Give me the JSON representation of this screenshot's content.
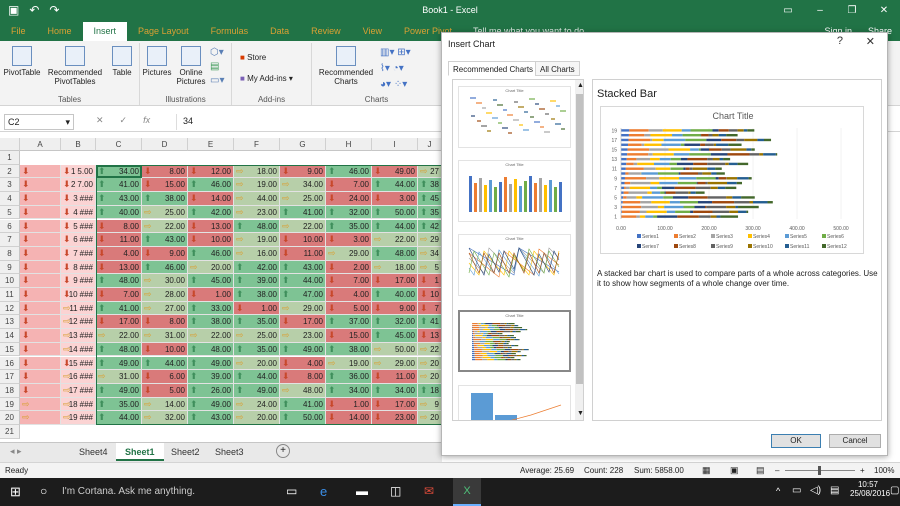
{
  "window": {
    "title": "Book1 - Excel",
    "qat_icons": [
      "save-icon",
      "undo-icon",
      "redo-icon"
    ]
  },
  "ribbon_tabs": [
    "File",
    "Home",
    "Insert",
    "Page Layout",
    "Formulas",
    "Data",
    "Review",
    "View",
    "Power Pivot"
  ],
  "active_tab": "Insert",
  "tell_me": "Tell me what you want to do",
  "sign_in": "Sign in",
  "share": "Share",
  "ribbon": {
    "tables": {
      "label": "Tables",
      "buttons": [
        "PivotTable",
        "Recommended PivotTables",
        "Table"
      ]
    },
    "illustrations": {
      "label": "Illustrations",
      "buttons": [
        "Pictures",
        "Online Pictures"
      ]
    },
    "addins": {
      "label": "Add-ins",
      "store": "Store",
      "my_addins": "My Add-ins"
    },
    "charts": {
      "label": "Charts",
      "recommended": "Recommended Charts"
    }
  },
  "formula_bar": {
    "name_box": "C2",
    "fx_label": "fx",
    "value": "34"
  },
  "columns": [
    "A",
    "B",
    "C",
    "D",
    "E",
    "F",
    "G",
    "H",
    "I",
    "J"
  ],
  "rows": [
    {
      "n": "2",
      "cells": [
        [
          "dn",
          ""
        ],
        [
          "dn",
          "1"
        ],
        [
          "up",
          "34.00"
        ],
        [
          "dn",
          "8.00"
        ],
        [
          "dn",
          "12.00"
        ],
        [
          "rt",
          "18.00"
        ],
        [
          "dn",
          "9.00"
        ],
        [
          "up",
          "46.00"
        ],
        [
          "dn",
          "49.00"
        ],
        [
          "rt",
          "27"
        ]
      ],
      "b2": "5.00"
    },
    {
      "n": "3",
      "cells": [
        [
          "dn",
          ""
        ],
        [
          "dn",
          "2"
        ],
        [
          "up",
          "41.00"
        ],
        [
          "dn",
          "15.00"
        ],
        [
          "up",
          "46.00"
        ],
        [
          "rt",
          "19.00"
        ],
        [
          "rt",
          "34.00"
        ],
        [
          "dn",
          "7.00"
        ],
        [
          "up",
          "44.00"
        ],
        [
          "up",
          "38"
        ]
      ],
      "b2": "7.00"
    },
    {
      "n": "4",
      "cells": [
        [
          "dn",
          ""
        ],
        [
          "dn",
          "3"
        ],
        [
          "up",
          "43.00"
        ],
        [
          "up",
          "38.00"
        ],
        [
          "dn",
          "14.00"
        ],
        [
          "rt",
          "44.00"
        ],
        [
          "rt",
          "25.00"
        ],
        [
          "dn",
          "24.00"
        ],
        [
          "dn",
          "3.00"
        ],
        [
          "up",
          "45"
        ]
      ],
      "b2": "###"
    },
    {
      "n": "5",
      "cells": [
        [
          "dn",
          ""
        ],
        [
          "dn",
          "4"
        ],
        [
          "up",
          "40.00"
        ],
        [
          "rt",
          "25.00"
        ],
        [
          "up",
          "42.00"
        ],
        [
          "rt",
          "23.00"
        ],
        [
          "up",
          "41.00"
        ],
        [
          "up",
          "32.00"
        ],
        [
          "up",
          "50.00"
        ],
        [
          "up",
          "35"
        ]
      ],
      "b2": "###"
    },
    {
      "n": "6",
      "cells": [
        [
          "dn",
          ""
        ],
        [
          "dn",
          "5"
        ],
        [
          "dn",
          "8.00"
        ],
        [
          "rt",
          "22.00"
        ],
        [
          "dn",
          "13.00"
        ],
        [
          "up",
          "48.00"
        ],
        [
          "rt",
          "22.00"
        ],
        [
          "up",
          "35.00"
        ],
        [
          "up",
          "44.00"
        ],
        [
          "up",
          "42"
        ]
      ],
      "b2": "###"
    },
    {
      "n": "7",
      "cells": [
        [
          "dn",
          ""
        ],
        [
          "dn",
          "6"
        ],
        [
          "dn",
          "11.00"
        ],
        [
          "up",
          "43.00"
        ],
        [
          "dn",
          "10.00"
        ],
        [
          "rt",
          "19.00"
        ],
        [
          "dn",
          "10.00"
        ],
        [
          "dn",
          "3.00"
        ],
        [
          "rt",
          "22.00"
        ],
        [
          "rt",
          "29"
        ]
      ],
      "b2": "###"
    },
    {
      "n": "8",
      "cells": [
        [
          "dn",
          ""
        ],
        [
          "dn",
          "7"
        ],
        [
          "dn",
          "4.00"
        ],
        [
          "dn",
          "9.00"
        ],
        [
          "up",
          "46.00"
        ],
        [
          "rt",
          "16.00"
        ],
        [
          "dn",
          "11.00"
        ],
        [
          "rt",
          "29.00"
        ],
        [
          "up",
          "48.00"
        ],
        [
          "rt",
          "34"
        ]
      ],
      "b2": "###"
    },
    {
      "n": "9",
      "cells": [
        [
          "dn",
          ""
        ],
        [
          "dn",
          "8"
        ],
        [
          "dn",
          "13.00"
        ],
        [
          "up",
          "46.00"
        ],
        [
          "rt",
          "20.00"
        ],
        [
          "up",
          "42.00"
        ],
        [
          "up",
          "43.00"
        ],
        [
          "dn",
          "2.00"
        ],
        [
          "rt",
          "18.00"
        ],
        [
          "rt",
          "5"
        ]
      ],
      "b2": "###"
    },
    {
      "n": "10",
      "cells": [
        [
          "dn",
          ""
        ],
        [
          "dn",
          "9"
        ],
        [
          "up",
          "48.00"
        ],
        [
          "rt",
          "30.00"
        ],
        [
          "up",
          "45.00"
        ],
        [
          "up",
          "39.00"
        ],
        [
          "up",
          "44.00"
        ],
        [
          "dn",
          "7.00"
        ],
        [
          "dn",
          "17.00"
        ],
        [
          "dn",
          "1"
        ]
      ],
      "b2": "###"
    },
    {
      "n": "11",
      "cells": [
        [
          "dn",
          ""
        ],
        [
          "dn",
          "10"
        ],
        [
          "dn",
          "7.00"
        ],
        [
          "rt",
          "28.00"
        ],
        [
          "dn",
          "1.00"
        ],
        [
          "up",
          "38.00"
        ],
        [
          "up",
          "47.00"
        ],
        [
          "dn",
          "4.00"
        ],
        [
          "up",
          "40.00"
        ],
        [
          "dn",
          "10"
        ]
      ],
      "b2": "###"
    },
    {
      "n": "12",
      "cells": [
        [
          "dn",
          ""
        ],
        [
          "rt",
          "11"
        ],
        [
          "up",
          "41.00"
        ],
        [
          "rt",
          "27.00"
        ],
        [
          "up",
          "33.00"
        ],
        [
          "dn",
          "1.00"
        ],
        [
          "rt",
          "29.00"
        ],
        [
          "dn",
          "5.00"
        ],
        [
          "dn",
          "9.00"
        ],
        [
          "dn",
          "7"
        ]
      ],
      "b2": "###"
    },
    {
      "n": "13",
      "cells": [
        [
          "dn",
          ""
        ],
        [
          "rt",
          "12"
        ],
        [
          "dn",
          "17.00"
        ],
        [
          "dn",
          "8.00"
        ],
        [
          "up",
          "38.00"
        ],
        [
          "up",
          "35.00"
        ],
        [
          "dn",
          "17.00"
        ],
        [
          "up",
          "37.00"
        ],
        [
          "up",
          "32.00"
        ],
        [
          "up",
          "41"
        ]
      ],
      "b2": "###"
    },
    {
      "n": "14",
      "cells": [
        [
          "dn",
          ""
        ],
        [
          "rt",
          "13"
        ],
        [
          "rt",
          "22.00"
        ],
        [
          "rt",
          "31.00"
        ],
        [
          "rt",
          "22.00"
        ],
        [
          "rt",
          "25.00"
        ],
        [
          "rt",
          "23.00"
        ],
        [
          "dn",
          "15.00"
        ],
        [
          "up",
          "45.00"
        ],
        [
          "dn",
          "13"
        ]
      ],
      "b2": "###"
    },
    {
      "n": "15",
      "cells": [
        [
          "dn",
          ""
        ],
        [
          "rt",
          "14"
        ],
        [
          "up",
          "48.00"
        ],
        [
          "dn",
          "10.00"
        ],
        [
          "up",
          "48.00"
        ],
        [
          "up",
          "35.00"
        ],
        [
          "up",
          "49.00"
        ],
        [
          "up",
          "38.00"
        ],
        [
          "rt",
          "50.00"
        ],
        [
          "rt",
          "22"
        ]
      ],
      "b2": "###"
    },
    {
      "n": "16",
      "cells": [
        [
          "dn",
          ""
        ],
        [
          "dn",
          "15"
        ],
        [
          "up",
          "49.00"
        ],
        [
          "up",
          "44.00"
        ],
        [
          "up",
          "49.00"
        ],
        [
          "rt",
          "20.00"
        ],
        [
          "dn",
          "4.00"
        ],
        [
          "rt",
          "19.00"
        ],
        [
          "rt",
          "29.00"
        ],
        [
          "rt",
          "20"
        ]
      ],
      "b2": "###"
    },
    {
      "n": "17",
      "cells": [
        [
          "dn",
          ""
        ],
        [
          "rt",
          "16"
        ],
        [
          "rt",
          "31.00"
        ],
        [
          "dn",
          "6.00"
        ],
        [
          "up",
          "39.00"
        ],
        [
          "up",
          "44.00"
        ],
        [
          "dn",
          "8.00"
        ],
        [
          "up",
          "36.00"
        ],
        [
          "dn",
          "11.00"
        ],
        [
          "rt",
          "20"
        ]
      ],
      "b2": "###"
    },
    {
      "n": "18",
      "cells": [
        [
          "dn",
          ""
        ],
        [
          "rt",
          "17"
        ],
        [
          "up",
          "49.00"
        ],
        [
          "dn",
          "5.00"
        ],
        [
          "up",
          "26.00"
        ],
        [
          "up",
          "49.00"
        ],
        [
          "rt",
          "48.00"
        ],
        [
          "up",
          "34.00"
        ],
        [
          "up",
          "34.00"
        ],
        [
          "up",
          "18"
        ]
      ],
      "b2": "###"
    },
    {
      "n": "19",
      "cells": [
        [
          "rt",
          ""
        ],
        [
          "rt",
          "18"
        ],
        [
          "up",
          "35.00"
        ],
        [
          "rt",
          "14.00"
        ],
        [
          "up",
          "49.00"
        ],
        [
          "rt",
          "24.00"
        ],
        [
          "up",
          "41.00"
        ],
        [
          "dn",
          "1.00"
        ],
        [
          "dn",
          "17.00"
        ],
        [
          "rt",
          "9"
        ]
      ],
      "b2": "###"
    },
    {
      "n": "20",
      "cells": [
        [
          "rt",
          ""
        ],
        [
          "rt",
          "19"
        ],
        [
          "up",
          "44.00"
        ],
        [
          "rt",
          "32.00"
        ],
        [
          "up",
          "43.00"
        ],
        [
          "rt",
          "20.00"
        ],
        [
          "up",
          "50.00"
        ],
        [
          "dn",
          "14.00"
        ],
        [
          "dn",
          "23.00"
        ],
        [
          "rt",
          "20"
        ]
      ],
      "b2": "###"
    }
  ],
  "sheet_tabs": [
    "Sheet4",
    "Sheet1",
    "Sheet2",
    "Sheet3"
  ],
  "active_sheet": "Sheet1",
  "status": {
    "ready": "Ready",
    "average": "Average: 25.69",
    "count": "Count: 228",
    "sum": "Sum: 5858.00",
    "zoom": "100%"
  },
  "taskbar": {
    "cortana": "I'm Cortana. Ask me anything.",
    "time": "10:57",
    "date": "25/08/2016"
  },
  "dialog": {
    "title": "Insert Chart",
    "help": "?",
    "close": "✕",
    "tabs": [
      "Recommended Charts",
      "All Charts"
    ],
    "thumb_title": "Chart Title",
    "selected_type": "Stacked Bar",
    "description": "A stacked bar chart is used to compare parts of a whole across categories. Use it to show how segments of a whole change over time.",
    "ok": "OK",
    "cancel": "Cancel"
  },
  "chart_data": {
    "type": "bar",
    "title": "Chart Title",
    "stacked": true,
    "orientation": "horizontal",
    "categories": [
      "1",
      "2",
      "3",
      "4",
      "5",
      "6",
      "7",
      "8",
      "9",
      "10",
      "11",
      "12",
      "13",
      "14",
      "15",
      "16",
      "17",
      "18",
      "19"
    ],
    "y_ticks": [
      "19",
      "17",
      "15",
      "13",
      "11",
      "9",
      "7",
      "5",
      "3",
      "1"
    ],
    "x_ticks": [
      "0.00",
      "100.00",
      "200.00",
      "300.00",
      "400.00",
      "500.00"
    ],
    "xlim": [
      0,
      500
    ],
    "legend": [
      "Series1",
      "Series2",
      "Series3",
      "Series4",
      "Series5",
      "Series6",
      "Series7",
      "Series8",
      "Series9",
      "Series10",
      "Series11",
      "Series12"
    ],
    "colors": [
      "#4472c4",
      "#ed7d31",
      "#a5a5a5",
      "#ffc000",
      "#5b9bd5",
      "#70ad47",
      "#264478",
      "#9e480e",
      "#636363",
      "#997300",
      "#255e91",
      "#43682b"
    ],
    "values": [
      [
        1,
        34,
        8,
        12,
        18,
        9,
        46,
        49,
        27,
        13,
        9,
        40
      ],
      [
        2,
        41,
        15,
        46,
        19,
        34,
        7,
        44,
        38,
        20,
        19,
        4
      ],
      [
        3,
        43,
        38,
        14,
        44,
        25,
        24,
        3,
        45,
        21,
        6,
        47
      ],
      [
        4,
        40,
        25,
        42,
        23,
        41,
        32,
        50,
        35,
        8,
        33,
        12
      ],
      [
        5,
        8,
        22,
        13,
        48,
        22,
        35,
        44,
        42,
        14,
        20,
        31
      ],
      [
        6,
        11,
        43,
        10,
        19,
        10,
        3,
        22,
        29,
        5,
        12,
        20
      ],
      [
        7,
        4,
        9,
        46,
        16,
        11,
        29,
        48,
        34,
        16,
        17,
        25
      ],
      [
        8,
        13,
        46,
        20,
        42,
        43,
        2,
        18,
        5,
        44,
        22,
        12
      ],
      [
        9,
        48,
        30,
        45,
        39,
        44,
        7,
        17,
        1,
        24,
        26,
        7
      ],
      [
        10,
        7,
        28,
        1,
        38,
        47,
        4,
        40,
        10,
        20,
        12,
        19
      ],
      [
        11,
        41,
        27,
        33,
        1,
        29,
        5,
        9,
        7,
        33,
        18,
        15
      ],
      [
        12,
        17,
        8,
        38,
        35,
        17,
        37,
        32,
        41,
        8,
        20,
        24
      ],
      [
        13,
        22,
        31,
        22,
        25,
        23,
        15,
        45,
        13,
        15,
        8,
        16
      ],
      [
        14,
        48,
        10,
        48,
        35,
        49,
        38,
        50,
        22,
        9,
        29,
        3
      ],
      [
        15,
        49,
        44,
        49,
        20,
        4,
        19,
        29,
        20,
        36,
        11,
        8
      ],
      [
        16,
        31,
        6,
        39,
        44,
        8,
        36,
        11,
        20,
        5,
        28,
        30
      ],
      [
        17,
        49,
        5,
        26,
        49,
        48,
        34,
        34,
        18,
        30,
        15,
        16
      ],
      [
        18,
        35,
        14,
        49,
        24,
        41,
        1,
        17,
        9,
        14,
        17,
        26
      ],
      [
        19,
        44,
        32,
        43,
        20,
        50,
        14,
        23,
        20,
        14,
        8,
        16
      ]
    ]
  }
}
